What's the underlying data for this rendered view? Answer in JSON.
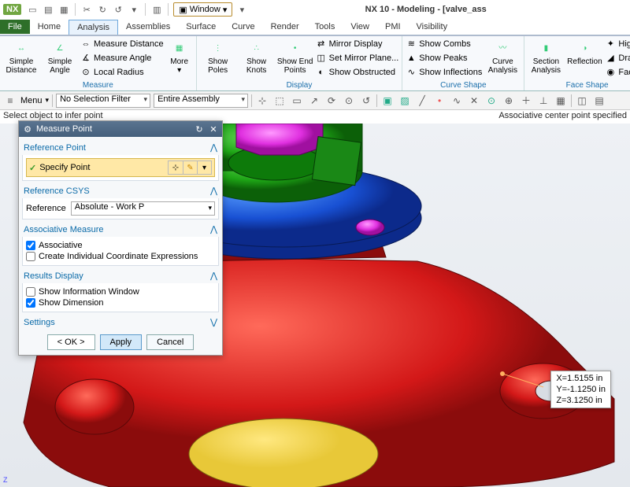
{
  "app": {
    "title": "NX 10 - Modeling - [valve_ass"
  },
  "qat": {
    "window_label": "Window"
  },
  "menu": {
    "items": [
      "File",
      "Home",
      "Analysis",
      "Assemblies",
      "Surface",
      "Curve",
      "Render",
      "Tools",
      "View",
      "PMI",
      "Visibility"
    ],
    "active": "Analysis"
  },
  "ribbon": {
    "groups": [
      {
        "name": "Measure",
        "big": [
          {
            "id": "simple-distance",
            "label1": "Simple",
            "label2": "Distance"
          },
          {
            "id": "simple-angle",
            "label1": "Simple",
            "label2": "Angle"
          }
        ],
        "small": [
          {
            "id": "measure-distance",
            "label": "Measure Distance"
          },
          {
            "id": "measure-angle",
            "label": "Measure Angle"
          },
          {
            "id": "local-radius",
            "label": "Local Radius"
          }
        ],
        "more": {
          "id": "more",
          "label": "More"
        }
      },
      {
        "name": "Display",
        "big": [
          {
            "id": "show-poles",
            "label1": "Show",
            "label2": "Poles"
          },
          {
            "id": "show-knots",
            "label1": "Show",
            "label2": "Knots"
          },
          {
            "id": "show-end-points",
            "label1": "Show End",
            "label2": "Points"
          }
        ],
        "small": [
          {
            "id": "mirror-display",
            "label": "Mirror Display"
          },
          {
            "id": "set-mirror-plane",
            "label": "Set Mirror Plane..."
          },
          {
            "id": "show-obstructed",
            "label": "Show Obstructed"
          }
        ]
      },
      {
        "name": "Curve Shape",
        "small": [
          {
            "id": "show-combs",
            "label": "Show Combs"
          },
          {
            "id": "show-peaks",
            "label": "Show Peaks"
          },
          {
            "id": "show-inflections",
            "label": "Show Inflections"
          }
        ],
        "big": [
          {
            "id": "curve-analysis",
            "label1": "Curve",
            "label2": "Analysis"
          }
        ]
      },
      {
        "name": "Face Shape",
        "big": [
          {
            "id": "section-analysis",
            "label1": "Section",
            "label2": "Analysis"
          },
          {
            "id": "reflection",
            "label1": "Reflection",
            "label2": ""
          }
        ],
        "small": [
          {
            "id": "highlight",
            "label": "Highlig"
          },
          {
            "id": "draft-analysis",
            "label": "Draft A"
          },
          {
            "id": "face-curvature",
            "label": "Face C"
          }
        ]
      }
    ]
  },
  "selbar": {
    "menu": "Menu",
    "filter": "No Selection Filter",
    "scope": "Entire Assembly"
  },
  "status": {
    "left": "Select object to infer point",
    "right": "Associative center point specified"
  },
  "dialog": {
    "title": "Measure Point",
    "sections": {
      "ref_point": {
        "title": "Reference Point",
        "specify": "Specify Point"
      },
      "ref_csys": {
        "title": "Reference CSYS",
        "label": "Reference",
        "value": "Absolute - Work P"
      },
      "assoc": {
        "title": "Associative Measure",
        "chk1": "Associative",
        "val1": true,
        "chk2": "Create Individual Coordinate Expressions",
        "val2": false
      },
      "results": {
        "title": "Results Display",
        "chk1": "Show Information Window",
        "val1": false,
        "chk2": "Show Dimension",
        "val2": true
      },
      "settings": {
        "title": "Settings"
      }
    },
    "buttons": {
      "ok": "< OK >",
      "apply": "Apply",
      "cancel": "Cancel"
    }
  },
  "tooltip": {
    "x": "X=1.5155 in",
    "y": "Y=-1.1250 in",
    "z": "Z=3.1250 in"
  }
}
